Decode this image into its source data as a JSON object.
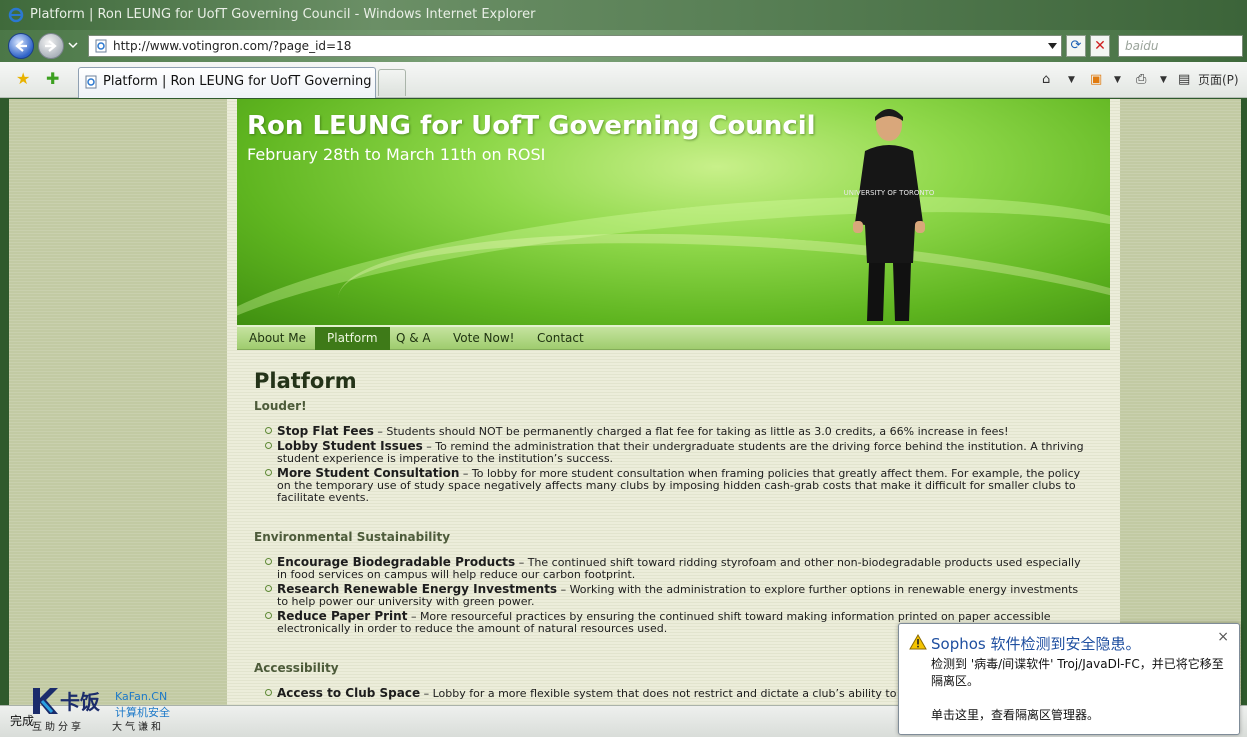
{
  "window": {
    "title": "Platform | Ron LEUNG for UofT Governing Council - Windows Internet Explorer",
    "address": "http://www.votingron.com/?page_id=18",
    "search_placeholder": "baidu",
    "tab_title": "Platform | Ron LEUNG for UofT Governing C...",
    "page_menu_label": "页面(P)",
    "status": "完成"
  },
  "site": {
    "title": "Ron LEUNG for UofT Governing Council",
    "subtitle": "February 28th to March 11th on ROSI",
    "shirt_text": "UNIVERSITY OF TORONTO"
  },
  "menu": [
    {
      "label": "About Me"
    },
    {
      "label": "Platform",
      "active": true
    },
    {
      "label": "Q & A"
    },
    {
      "label": "Vote Now!"
    },
    {
      "label": "Contact"
    }
  ],
  "content": {
    "title": "Platform",
    "sections": [
      {
        "heading": "Louder!",
        "items": [
          {
            "title": "Stop Flat Fees",
            "text": " – Students should NOT be permanently charged a flat fee for taking as little as 3.0 credits, a 66% increase in fees!"
          },
          {
            "title": "Lobby Student Issues",
            "text": " – To remind the administration that their undergraduate students are the driving force behind the institution. A thriving student experience is imperative to the institution’s success."
          },
          {
            "title": "More Student Consultation",
            "text": " – To lobby for more student consultation when framing policies that greatly affect them. For example, the policy on the temporary use of study space negatively affects many clubs by imposing hidden cash-grab costs that make it difficult for smaller clubs to facilitate events."
          }
        ]
      },
      {
        "heading": "Environmental Sustainability",
        "items": [
          {
            "title": "Encourage Biodegradable Products",
            "text": " – The continued shift toward ridding styrofoam and other non-biodegradable products used especially in food services on campus will help reduce our carbon footprint."
          },
          {
            "title": "Research Renewable Energy Investments",
            "text": " – Working with the administration to explore further options in renewable energy investments to help power our university with green power."
          },
          {
            "title": "Reduce Paper Print",
            "text": " – More resourceful practices by ensuring the continued shift toward making information printed on paper accessible electronically in order to reduce the amount of natural resources used."
          }
        ]
      },
      {
        "heading": "Accessibility",
        "items": [
          {
            "title": "Access to Club Space",
            "text": " – Lobby for a more flexible system that does not restrict and dictate a club’s ability to"
          }
        ]
      }
    ]
  },
  "kafan": {
    "brand": "卡饭",
    "url": "KaFan.CN",
    "security": "计算机安全",
    "slogan_left": "互助分享",
    "slogan_right": "大气谦和"
  },
  "sophos": {
    "title": "Sophos 软件检测到安全隐患。",
    "body": "检测到 '病毒/间谍软件' Troj/JavaDl-FC，并已将它移至隔离区。",
    "link": "单击这里，查看隔离区管理器。",
    "close": "×"
  },
  "colors": {
    "accent_green": "#3e7a18",
    "page_bg": "#ecedda",
    "link_blue": "#1f4fa0"
  }
}
